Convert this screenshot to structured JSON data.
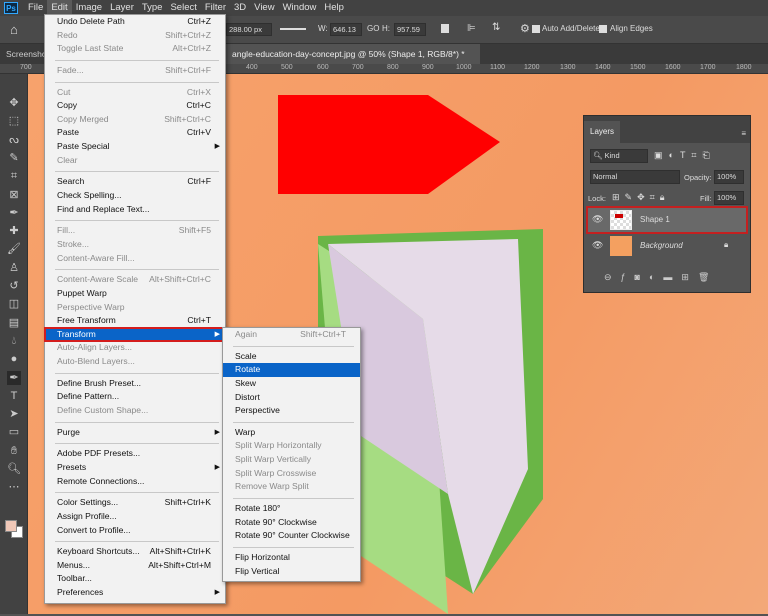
{
  "menubar": {
    "app_icon": "Ps",
    "items": [
      "File",
      "Edit",
      "Image",
      "Layer",
      "Type",
      "Select",
      "Filter",
      "3D",
      "View",
      "Window",
      "Help"
    ]
  },
  "options": {
    "width_px": "288.00 px",
    "w_label": "W:",
    "w_value": "646.13",
    "h_label": "H:",
    "h_value": "957.59",
    "auto_add_delete": "Auto Add/Delete",
    "align_edges": "Align Edges"
  },
  "tabs": {
    "first": "Screensho",
    "document": "angle-education-day-concept.jpg @ 50% (Shape 1, RGB/8*) *",
    "close": "×"
  },
  "ruler": [
    "700",
    "400",
    "500",
    "600",
    "700",
    "800",
    "900",
    "1000",
    "1100",
    "1200",
    "1300",
    "1400",
    "1500",
    "1600",
    "1700",
    "1800"
  ],
  "edit_menu": [
    {
      "label": "Undo Delete Path",
      "shortcut": "Ctrl+Z"
    },
    {
      "label": "Redo",
      "shortcut": "Shift+Ctrl+Z",
      "disabled": true
    },
    {
      "label": "Toggle Last State",
      "shortcut": "Alt+Ctrl+Z",
      "disabled": true
    },
    {
      "sep": true
    },
    {
      "label": "Fade...",
      "shortcut": "Shift+Ctrl+F",
      "disabled": true
    },
    {
      "sep": true
    },
    {
      "label": "Cut",
      "shortcut": "Ctrl+X",
      "disabled": true
    },
    {
      "label": "Copy",
      "shortcut": "Ctrl+C"
    },
    {
      "label": "Copy Merged",
      "shortcut": "Shift+Ctrl+C",
      "disabled": true
    },
    {
      "label": "Paste",
      "shortcut": "Ctrl+V"
    },
    {
      "label": "Paste Special",
      "submenu": true
    },
    {
      "label": "Clear",
      "disabled": true
    },
    {
      "sep": true
    },
    {
      "label": "Search",
      "shortcut": "Ctrl+F"
    },
    {
      "label": "Check Spelling..."
    },
    {
      "label": "Find and Replace Text..."
    },
    {
      "sep": true
    },
    {
      "label": "Fill...",
      "shortcut": "Shift+F5",
      "disabled": true
    },
    {
      "label": "Stroke...",
      "disabled": true
    },
    {
      "label": "Content-Aware Fill...",
      "disabled": true
    },
    {
      "sep": true
    },
    {
      "label": "Content-Aware Scale",
      "shortcut": "Alt+Shift+Ctrl+C",
      "disabled": true
    },
    {
      "label": "Puppet Warp"
    },
    {
      "label": "Perspective Warp",
      "disabled": true
    },
    {
      "label": "Free Transform",
      "shortcut": "Ctrl+T"
    },
    {
      "label": "Transform",
      "submenu": true,
      "highlighted": true
    },
    {
      "label": "Auto-Align Layers...",
      "disabled": true
    },
    {
      "label": "Auto-Blend Layers...",
      "disabled": true
    },
    {
      "sep": true
    },
    {
      "label": "Define Brush Preset..."
    },
    {
      "label": "Define Pattern..."
    },
    {
      "label": "Define Custom Shape...",
      "disabled": true
    },
    {
      "sep": true
    },
    {
      "label": "Purge",
      "submenu": true
    },
    {
      "sep": true
    },
    {
      "label": "Adobe PDF Presets..."
    },
    {
      "label": "Presets",
      "submenu": true
    },
    {
      "label": "Remote Connections..."
    },
    {
      "sep": true
    },
    {
      "label": "Color Settings...",
      "shortcut": "Shift+Ctrl+K"
    },
    {
      "label": "Assign Profile..."
    },
    {
      "label": "Convert to Profile..."
    },
    {
      "sep": true
    },
    {
      "label": "Keyboard Shortcuts...",
      "shortcut": "Alt+Shift+Ctrl+K"
    },
    {
      "label": "Menus...",
      "shortcut": "Alt+Shift+Ctrl+M"
    },
    {
      "label": "Toolbar..."
    },
    {
      "label": "Preferences",
      "submenu": true
    }
  ],
  "transform_menu": [
    {
      "label": "Again",
      "shortcut": "Shift+Ctrl+T",
      "disabled": true
    },
    {
      "sep": true
    },
    {
      "label": "Scale"
    },
    {
      "label": "Rotate",
      "highlighted": true
    },
    {
      "label": "Skew"
    },
    {
      "label": "Distort"
    },
    {
      "label": "Perspective"
    },
    {
      "sep": true
    },
    {
      "label": "Warp"
    },
    {
      "label": "Split Warp Horizontally",
      "disabled": true
    },
    {
      "label": "Split Warp Vertically",
      "disabled": true
    },
    {
      "label": "Split Warp Crosswise",
      "disabled": true
    },
    {
      "label": "Remove Warp Split",
      "disabled": true
    },
    {
      "sep": true
    },
    {
      "label": "Rotate 180°"
    },
    {
      "label": "Rotate 90° Clockwise"
    },
    {
      "label": "Rotate 90° Counter Clockwise"
    },
    {
      "sep": true
    },
    {
      "label": "Flip Horizontal"
    },
    {
      "label": "Flip Vertical"
    }
  ],
  "layers": {
    "title": "Layers",
    "filter": "Kind",
    "blend": "Normal",
    "opacity_label": "Opacity:",
    "opacity": "100%",
    "lock_label": "Lock:",
    "fill_label": "Fill:",
    "fill": "100%",
    "items": [
      {
        "name": "Shape 1",
        "selected": true
      },
      {
        "name": "Background",
        "locked": true
      }
    ]
  },
  "colors": {
    "accent": "#0a64c8",
    "highlight_outline": "#d41d1d",
    "shape": "#ff0000",
    "canvas": "#f5a06a"
  }
}
